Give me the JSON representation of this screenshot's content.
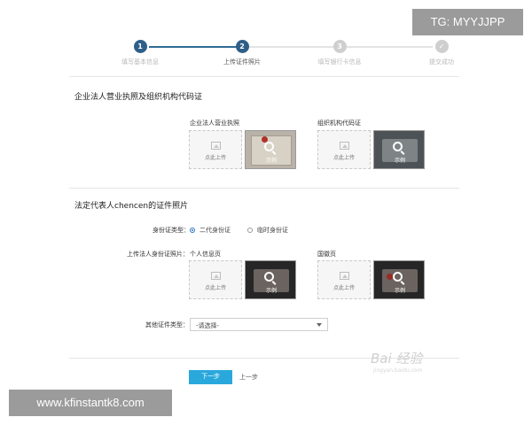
{
  "steps": [
    {
      "number": "1",
      "label": "填写基本信息",
      "state": "done"
    },
    {
      "number": "2",
      "label": "上传证件照片",
      "state": "active"
    },
    {
      "number": "3",
      "label": "填写银行卡信息",
      "state": "inactive"
    },
    {
      "number": "✓",
      "label": "提交成功",
      "state": "inactive"
    }
  ],
  "license_section": {
    "title": "企业法人营业执照及组织机构代码证",
    "business_license": {
      "caption": "企业法人营业执照",
      "upload_text": "点此上传",
      "sample_text": "示例"
    },
    "org_code": {
      "caption": "组织机构代码证",
      "upload_text": "点此上传",
      "sample_text": "示例"
    }
  },
  "rep_section": {
    "title": "法定代表人chencen的证件照片",
    "id_type_label": "身份证类型：",
    "id_type_options": [
      {
        "label": "二代身份证",
        "selected": true
      },
      {
        "label": "临时身份证",
        "selected": false
      }
    ],
    "upload_label": "上传法人身份证照片：",
    "front": {
      "caption": "个人信息页",
      "upload_text": "点此上传",
      "sample_text": "示例"
    },
    "back": {
      "caption": "国徽页",
      "upload_text": "点此上传",
      "sample_text": "示例"
    },
    "other_type_label": "其他证件类型：",
    "other_type_value": "-请选择-"
  },
  "buttons": {
    "next": "下一步",
    "prev": "上一步"
  },
  "overlays": {
    "tg": "TG: MYYJJPP",
    "site": "www.kfinstantk8.com",
    "watermark": "Bai 经验",
    "watermark_sub": "jingyan.baidu.com"
  }
}
